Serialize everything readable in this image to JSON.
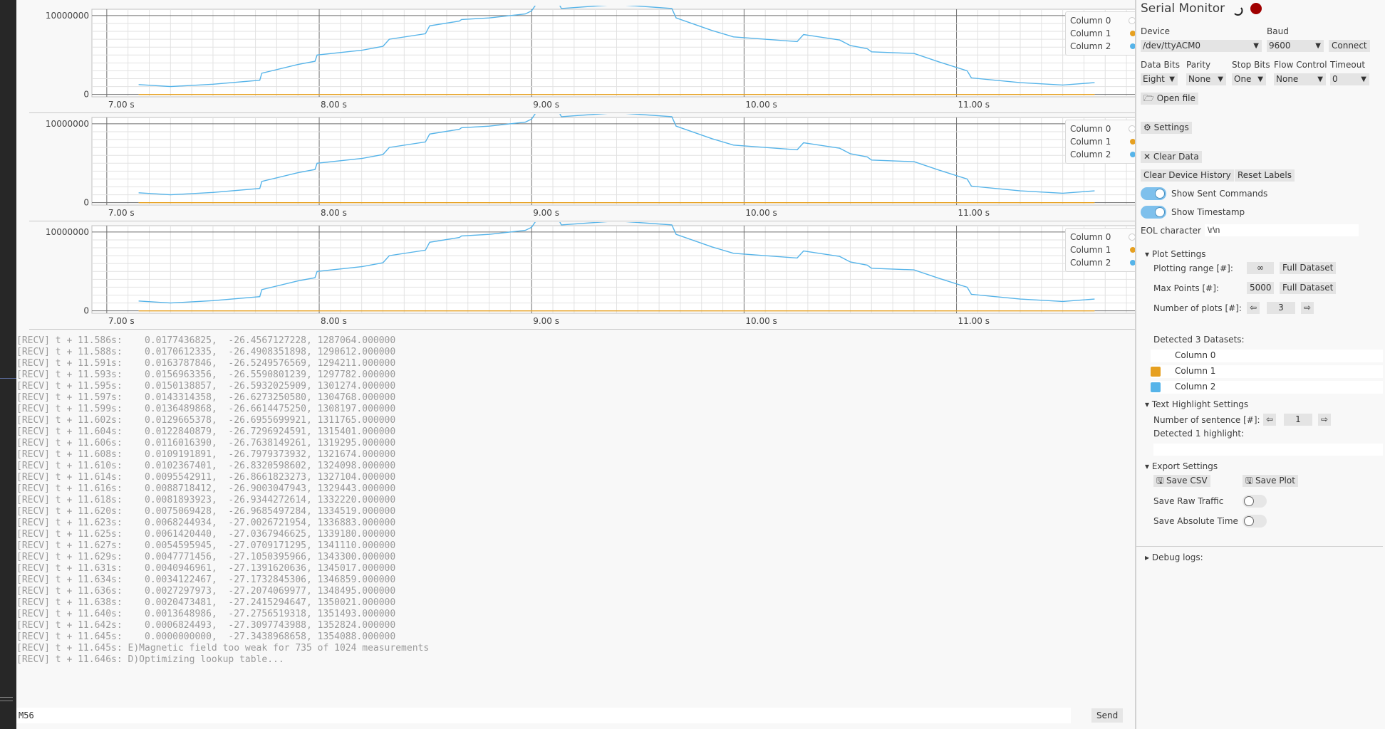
{
  "chart_data": [
    {
      "type": "line",
      "title": "",
      "xlabel": "",
      "ylabel": "",
      "xlim": [
        6.93,
        11.85
      ],
      "ylim": [
        -300000,
        10800000
      ],
      "x_ticks": [
        "7.00 s",
        "8.00 s",
        "9.00 s",
        "10.00 s",
        "11.00 s"
      ],
      "y_ticks": [
        "10000000",
        "0"
      ],
      "grid": true,
      "legend": "top-right",
      "series": [
        {
          "name": "Column 0",
          "color": "#eeeeee",
          "x": [
            7.15,
            11.65
          ],
          "y": [
            0,
            0
          ]
        },
        {
          "name": "Column 1",
          "color": "#e6a020",
          "x": [
            7.15,
            11.65
          ],
          "y": [
            0,
            0
          ]
        },
        {
          "name": "Column 2",
          "color": "#56b4e9",
          "x": [
            7.15,
            7.3,
            7.5,
            7.72,
            7.73,
            7.9,
            7.98,
            7.99,
            8.2,
            8.3,
            8.33,
            8.5,
            8.52,
            8.66,
            8.67,
            8.8,
            8.97,
            9.0,
            9.02,
            9.12,
            9.14,
            9.4,
            9.66,
            9.68,
            9.85,
            9.95,
            10.25,
            10.28,
            10.45,
            10.5,
            10.58,
            10.6,
            10.8,
            10.92,
            11.05,
            11.07,
            11.3,
            11.5,
            11.65
          ],
          "y": [
            1250000,
            1000000,
            1300000,
            1800000,
            2700000,
            3800000,
            4200000,
            5000000,
            5600000,
            6100000,
            7000000,
            7700000,
            8700000,
            9300000,
            9500000,
            9700000,
            10200000,
            10600000,
            11400000,
            11900000,
            10900000,
            11400000,
            10900000,
            9700000,
            8100000,
            7300000,
            6700000,
            7600000,
            6900000,
            6200000,
            5800000,
            5400000,
            5200000,
            4100000,
            3000000,
            2100000,
            1500000,
            1200000,
            1500000
          ]
        }
      ]
    },
    {
      "type": "line",
      "title": "",
      "xlabel": "",
      "ylabel": "",
      "xlim": [
        6.93,
        11.85
      ],
      "ylim": [
        -300000,
        10800000
      ],
      "x_ticks": [
        "7.00 s",
        "8.00 s",
        "9.00 s",
        "10.00 s",
        "11.00 s"
      ],
      "y_ticks": [
        "10000000",
        "0"
      ],
      "grid": true,
      "legend": "top-right",
      "series": [
        {
          "name": "Column 0",
          "color": "#eeeeee",
          "x": [
            7.15,
            11.65
          ],
          "y": [
            0,
            0
          ]
        },
        {
          "name": "Column 1",
          "color": "#e6a020",
          "x": [
            7.15,
            11.65
          ],
          "y": [
            0,
            0
          ]
        },
        {
          "name": "Column 2",
          "color": "#56b4e9",
          "x": [
            7.15,
            7.3,
            7.5,
            7.72,
            7.73,
            7.9,
            7.98,
            7.99,
            8.2,
            8.3,
            8.33,
            8.5,
            8.52,
            8.66,
            8.67,
            8.8,
            8.97,
            9.0,
            9.02,
            9.12,
            9.14,
            9.4,
            9.66,
            9.68,
            9.85,
            9.95,
            10.25,
            10.28,
            10.45,
            10.5,
            10.58,
            10.6,
            10.8,
            10.92,
            11.05,
            11.07,
            11.3,
            11.5,
            11.65
          ],
          "y": [
            1250000,
            1000000,
            1300000,
            1800000,
            2700000,
            3800000,
            4200000,
            5000000,
            5600000,
            6100000,
            7000000,
            7700000,
            8700000,
            9300000,
            9500000,
            9700000,
            10200000,
            10600000,
            11400000,
            11900000,
            10900000,
            11400000,
            10900000,
            9700000,
            8100000,
            7300000,
            6700000,
            7600000,
            6900000,
            6200000,
            5800000,
            5400000,
            5200000,
            4100000,
            3000000,
            2100000,
            1500000,
            1200000,
            1500000
          ]
        }
      ]
    },
    {
      "type": "line",
      "title": "",
      "xlabel": "",
      "ylabel": "",
      "xlim": [
        6.93,
        11.85
      ],
      "ylim": [
        -300000,
        10800000
      ],
      "x_ticks": [
        "7.00 s",
        "8.00 s",
        "9.00 s",
        "10.00 s",
        "11.00 s"
      ],
      "y_ticks": [
        "10000000",
        "0"
      ],
      "grid": true,
      "legend": "top-right",
      "series": [
        {
          "name": "Column 0",
          "color": "#eeeeee",
          "x": [
            7.15,
            11.65
          ],
          "y": [
            0,
            0
          ]
        },
        {
          "name": "Column 1",
          "color": "#e6a020",
          "x": [
            7.15,
            11.65
          ],
          "y": [
            0,
            0
          ]
        },
        {
          "name": "Column 2",
          "color": "#56b4e9",
          "x": [
            7.15,
            7.3,
            7.5,
            7.72,
            7.73,
            7.9,
            7.98,
            7.99,
            8.2,
            8.3,
            8.33,
            8.5,
            8.52,
            8.66,
            8.67,
            8.8,
            8.97,
            9.0,
            9.02,
            9.12,
            9.14,
            9.4,
            9.66,
            9.68,
            9.85,
            9.95,
            10.25,
            10.28,
            10.45,
            10.5,
            10.58,
            10.6,
            10.8,
            10.92,
            11.05,
            11.07,
            11.3,
            11.5,
            11.65
          ],
          "y": [
            1250000,
            1000000,
            1300000,
            1800000,
            2700000,
            3800000,
            4200000,
            5000000,
            5600000,
            6100000,
            7000000,
            7700000,
            8700000,
            9300000,
            9500000,
            9700000,
            10200000,
            10600000,
            11400000,
            11900000,
            10900000,
            11400000,
            10900000,
            9700000,
            8100000,
            7300000,
            6700000,
            7600000,
            6900000,
            6200000,
            5800000,
            5400000,
            5200000,
            4100000,
            3000000,
            2100000,
            1500000,
            1200000,
            1500000
          ]
        }
      ]
    }
  ],
  "log": {
    "lines": [
      "[RECV] t + 11.586s:    0.0177436825,  -26.4567127228, 1287064.000000",
      "[RECV] t + 11.588s:    0.0170612335,  -26.4908351898, 1290612.000000",
      "[RECV] t + 11.591s:    0.0163787846,  -26.5249576569, 1294211.000000",
      "[RECV] t + 11.593s:    0.0156963356,  -26.5590801239, 1297782.000000",
      "[RECV] t + 11.595s:    0.0150138857,  -26.5932025909, 1301274.000000",
      "[RECV] t + 11.597s:    0.0143314358,  -26.6273250580, 1304768.000000",
      "[RECV] t + 11.599s:    0.0136489868,  -26.6614475250, 1308197.000000",
      "[RECV] t + 11.602s:    0.0129665378,  -26.6955699921, 1311765.000000",
      "[RECV] t + 11.604s:    0.0122840879,  -26.7296924591, 1315401.000000",
      "[RECV] t + 11.606s:    0.0116016390,  -26.7638149261, 1319295.000000",
      "[RECV] t + 11.608s:    0.0109191891,  -26.7979373932, 1321674.000000",
      "[RECV] t + 11.610s:    0.0102367401,  -26.8320598602, 1324098.000000",
      "[RECV] t + 11.614s:    0.0095542911,  -26.8661823273, 1327104.000000",
      "[RECV] t + 11.616s:    0.0088718412,  -26.9003047943, 1329443.000000",
      "[RECV] t + 11.618s:    0.0081893923,  -26.9344272614, 1332220.000000",
      "[RECV] t + 11.620s:    0.0075069428,  -26.9685497284, 1334519.000000",
      "[RECV] t + 11.623s:    0.0068244934,  -27.0026721954, 1336883.000000",
      "[RECV] t + 11.625s:    0.0061420440,  -27.0367946625, 1339180.000000",
      "[RECV] t + 11.627s:    0.0054595945,  -27.0709171295, 1341110.000000",
      "[RECV] t + 11.629s:    0.0047771456,  -27.1050395966, 1343300.000000",
      "[RECV] t + 11.631s:    0.0040946961,  -27.1391620636, 1345017.000000",
      "[RECV] t + 11.634s:    0.0034122467,  -27.1732845306, 1346859.000000",
      "[RECV] t + 11.636s:    0.0027297973,  -27.2074069977, 1348495.000000",
      "[RECV] t + 11.638s:    0.0020473481,  -27.2415294647, 1350021.000000",
      "[RECV] t + 11.640s:    0.0013648986,  -27.2756519318, 1351493.000000",
      "[RECV] t + 11.642s:    0.0006824493,  -27.3097743988, 1352824.000000",
      "[RECV] t + 11.645s:    0.0000000000,  -27.3438968658, 1354088.000000",
      "[RECV] t + 11.645s: E)Magnetic field too weak for 735 of 1024 measurements",
      "[RECV] t + 11.646s: D)Optimizing lookup table..."
    ]
  },
  "command": {
    "value": "M56",
    "send_label": "Send"
  },
  "side": {
    "title": "Serial Monitor",
    "device_label": "Device",
    "device_value": "/dev/ttyACM0",
    "baud_label": "Baud",
    "baud_value": "9600",
    "connect_label": "Connect",
    "databits_label": "Data Bits",
    "databits_value": "Eight",
    "parity_label": "Parity",
    "parity_value": "None",
    "stopbits_label": "Stop Bits",
    "stopbits_value": "One",
    "flow_label": "Flow Control",
    "flow_value": "None",
    "timeout_label": "Timeout",
    "timeout_value": "0",
    "open_file_label": "Open file",
    "settings_label": "Settings",
    "clear_data_label": "Clear Data",
    "clear_history_label": "Clear Device History",
    "reset_labels_label": "Reset Labels",
    "show_sent_label": "Show Sent Commands",
    "show_timestamp_label": "Show Timestamp",
    "eol_label": "EOL character",
    "eol_value": "\\r\\n",
    "plot_settings_label": "Plot Settings",
    "plotting_range_label": "Plotting range [#]:",
    "plotting_range_value": "∞",
    "full_dataset_label": "Full Dataset",
    "max_points_label": "Max Points [#]:",
    "max_points_value": "5000",
    "num_plots_label": "Number of plots [#]:",
    "num_plots_value": "3",
    "detected_datasets_label": "Detected 3 Datasets:",
    "datasets": [
      {
        "name": "Column 0",
        "color": "#ffffff"
      },
      {
        "name": "Column 1",
        "color": "#e6a020"
      },
      {
        "name": "Column 2",
        "color": "#56b4e9"
      }
    ],
    "text_highlight_label": "Text Highlight Settings",
    "num_sentence_label": "Number of sentence [#]:",
    "num_sentence_value": "1",
    "detected_highlight_label": "Detected 1 highlight:",
    "export_settings_label": "Export Settings",
    "save_csv_label": "Save CSV",
    "save_plot_label": "Save Plot",
    "save_raw_label": "Save Raw Traffic",
    "save_abs_label": "Save Absolute Time",
    "debug_logs_label": "Debug logs:"
  },
  "colors": {
    "accent": "#56b4e9",
    "orange": "#e6a020",
    "record": "#a00000"
  }
}
